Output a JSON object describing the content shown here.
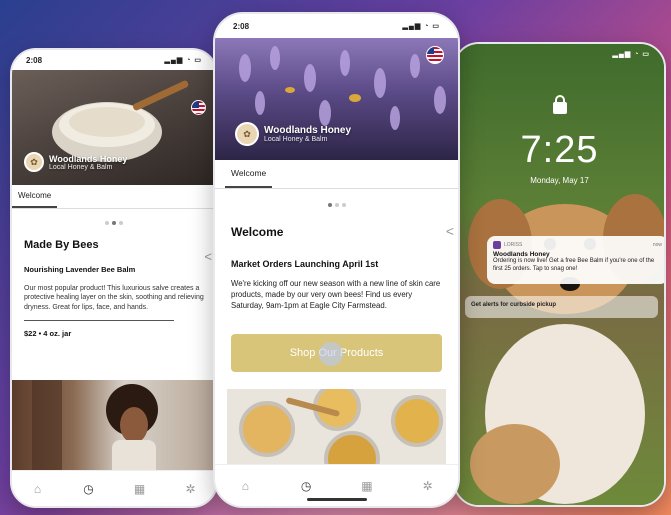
{
  "brand": {
    "name": "Woodlands Honey",
    "tagline": "Local Honey & Balm"
  },
  "phone_left": {
    "time": "2:08",
    "tab": "Welcome",
    "section_title": "Made By Bees",
    "product_name": "Nourishing Lavender Bee Balm",
    "product_desc": "Our most popular product! This luxurious salve creates a protective healing layer on the skin, soothing and relieving dryness. Great for lips, face, and hands.",
    "price": "$22 • 4 oz. jar"
  },
  "phone_center": {
    "time": "2:08",
    "tab": "Welcome",
    "section_title": "Welcome",
    "post_title": "Market Orders Launching April 1st",
    "post_body": "We're kicking off our new season with a new line of skin care products, made by our very own bees! Find us every Saturday, 9am-1pm at Eagle City Farmstead.",
    "cta": "Shop Our Products"
  },
  "phone_right": {
    "time": "7:25",
    "date": "Monday, May 17",
    "notif_app": "LORISS",
    "notif_title": "Woodlands Honey",
    "notif_body": "Ordering is now live! Get a free Bee Balm if you're one of the first 25 orders. Tap to snag one!",
    "notif_time": "now",
    "notif2_text": "Get alerts for curbside pickup"
  },
  "colors": {
    "cta": "#d8c57a",
    "accent": "#6b3fa0"
  },
  "icons": [
    "home-icon",
    "clock-icon",
    "qr-icon",
    "gear-icon",
    "share-icon",
    "lock-icon"
  ]
}
